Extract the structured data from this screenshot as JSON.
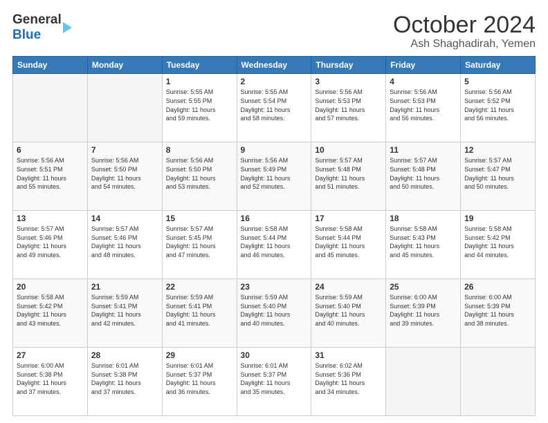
{
  "header": {
    "logo_top": "General",
    "logo_bottom": "Blue",
    "title": "October 2024",
    "subtitle": "Ash Shaghadirah, Yemen"
  },
  "calendar": {
    "days_of_week": [
      "Sunday",
      "Monday",
      "Tuesday",
      "Wednesday",
      "Thursday",
      "Friday",
      "Saturday"
    ],
    "weeks": [
      [
        {
          "day": "",
          "info": ""
        },
        {
          "day": "",
          "info": ""
        },
        {
          "day": "1",
          "info": "Sunrise: 5:55 AM\nSunset: 5:55 PM\nDaylight: 11 hours\nand 59 minutes."
        },
        {
          "day": "2",
          "info": "Sunrise: 5:55 AM\nSunset: 5:54 PM\nDaylight: 11 hours\nand 58 minutes."
        },
        {
          "day": "3",
          "info": "Sunrise: 5:56 AM\nSunset: 5:53 PM\nDaylight: 11 hours\nand 57 minutes."
        },
        {
          "day": "4",
          "info": "Sunrise: 5:56 AM\nSunset: 5:53 PM\nDaylight: 11 hours\nand 56 minutes."
        },
        {
          "day": "5",
          "info": "Sunrise: 5:56 AM\nSunset: 5:52 PM\nDaylight: 11 hours\nand 56 minutes."
        }
      ],
      [
        {
          "day": "6",
          "info": "Sunrise: 5:56 AM\nSunset: 5:51 PM\nDaylight: 11 hours\nand 55 minutes."
        },
        {
          "day": "7",
          "info": "Sunrise: 5:56 AM\nSunset: 5:50 PM\nDaylight: 11 hours\nand 54 minutes."
        },
        {
          "day": "8",
          "info": "Sunrise: 5:56 AM\nSunset: 5:50 PM\nDaylight: 11 hours\nand 53 minutes."
        },
        {
          "day": "9",
          "info": "Sunrise: 5:56 AM\nSunset: 5:49 PM\nDaylight: 11 hours\nand 52 minutes."
        },
        {
          "day": "10",
          "info": "Sunrise: 5:57 AM\nSunset: 5:48 PM\nDaylight: 11 hours\nand 51 minutes."
        },
        {
          "day": "11",
          "info": "Sunrise: 5:57 AM\nSunset: 5:48 PM\nDaylight: 11 hours\nand 50 minutes."
        },
        {
          "day": "12",
          "info": "Sunrise: 5:57 AM\nSunset: 5:47 PM\nDaylight: 11 hours\nand 50 minutes."
        }
      ],
      [
        {
          "day": "13",
          "info": "Sunrise: 5:57 AM\nSunset: 5:46 PM\nDaylight: 11 hours\nand 49 minutes."
        },
        {
          "day": "14",
          "info": "Sunrise: 5:57 AM\nSunset: 5:46 PM\nDaylight: 11 hours\nand 48 minutes."
        },
        {
          "day": "15",
          "info": "Sunrise: 5:57 AM\nSunset: 5:45 PM\nDaylight: 11 hours\nand 47 minutes."
        },
        {
          "day": "16",
          "info": "Sunrise: 5:58 AM\nSunset: 5:44 PM\nDaylight: 11 hours\nand 46 minutes."
        },
        {
          "day": "17",
          "info": "Sunrise: 5:58 AM\nSunset: 5:44 PM\nDaylight: 11 hours\nand 45 minutes."
        },
        {
          "day": "18",
          "info": "Sunrise: 5:58 AM\nSunset: 5:43 PM\nDaylight: 11 hours\nand 45 minutes."
        },
        {
          "day": "19",
          "info": "Sunrise: 5:58 AM\nSunset: 5:42 PM\nDaylight: 11 hours\nand 44 minutes."
        }
      ],
      [
        {
          "day": "20",
          "info": "Sunrise: 5:58 AM\nSunset: 5:42 PM\nDaylight: 11 hours\nand 43 minutes."
        },
        {
          "day": "21",
          "info": "Sunrise: 5:59 AM\nSunset: 5:41 PM\nDaylight: 11 hours\nand 42 minutes."
        },
        {
          "day": "22",
          "info": "Sunrise: 5:59 AM\nSunset: 5:41 PM\nDaylight: 11 hours\nand 41 minutes."
        },
        {
          "day": "23",
          "info": "Sunrise: 5:59 AM\nSunset: 5:40 PM\nDaylight: 11 hours\nand 40 minutes."
        },
        {
          "day": "24",
          "info": "Sunrise: 5:59 AM\nSunset: 5:40 PM\nDaylight: 11 hours\nand 40 minutes."
        },
        {
          "day": "25",
          "info": "Sunrise: 6:00 AM\nSunset: 5:39 PM\nDaylight: 11 hours\nand 39 minutes."
        },
        {
          "day": "26",
          "info": "Sunrise: 6:00 AM\nSunset: 5:39 PM\nDaylight: 11 hours\nand 38 minutes."
        }
      ],
      [
        {
          "day": "27",
          "info": "Sunrise: 6:00 AM\nSunset: 5:38 PM\nDaylight: 11 hours\nand 37 minutes."
        },
        {
          "day": "28",
          "info": "Sunrise: 6:01 AM\nSunset: 5:38 PM\nDaylight: 11 hours\nand 37 minutes."
        },
        {
          "day": "29",
          "info": "Sunrise: 6:01 AM\nSunset: 5:37 PM\nDaylight: 11 hours\nand 36 minutes."
        },
        {
          "day": "30",
          "info": "Sunrise: 6:01 AM\nSunset: 5:37 PM\nDaylight: 11 hours\nand 35 minutes."
        },
        {
          "day": "31",
          "info": "Sunrise: 6:02 AM\nSunset: 5:36 PM\nDaylight: 11 hours\nand 34 minutes."
        },
        {
          "day": "",
          "info": ""
        },
        {
          "day": "",
          "info": ""
        }
      ]
    ]
  }
}
